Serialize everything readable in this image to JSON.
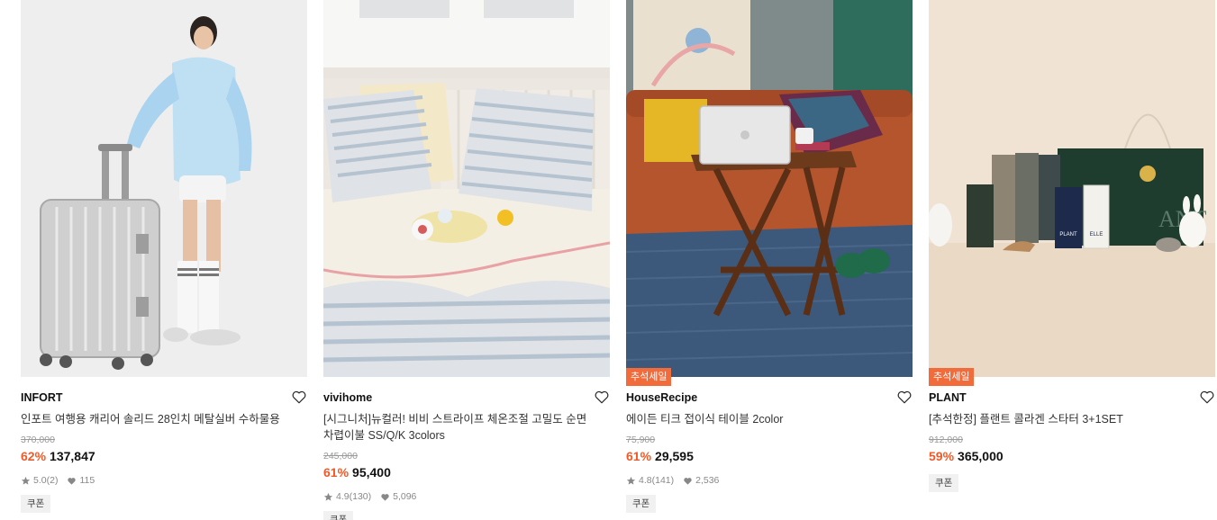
{
  "products": [
    {
      "brand": "INFORT",
      "title": "인포트 여행용 캐리어 솔리드 28인치 메탈실버 수하물용",
      "original_price": "370,000",
      "discount": "62%",
      "price": "137,847",
      "rating": "5.0",
      "review_count": "(2)",
      "likes": "115",
      "coupon": "쿠폰",
      "badge": ""
    },
    {
      "brand": "vivihome",
      "title": "[시그니처]뉴컬러! 비비 스트라이프 체온조절 고밀도 순면 차렵이불 SS/Q/K 3colors",
      "original_price": "245,000",
      "discount": "61%",
      "price": "95,400",
      "rating": "4.9",
      "review_count": "(130)",
      "likes": "5,096",
      "coupon": "쿠폰",
      "badge": ""
    },
    {
      "brand": "HouseRecipe",
      "title": "에이든 티크 접이식 테이블 2color",
      "original_price": "75,900",
      "discount": "61%",
      "price": "29,595",
      "rating": "4.8",
      "review_count": "(141)",
      "likes": "2,536",
      "coupon": "쿠폰",
      "badge": "추석세일"
    },
    {
      "brand": "PLANT",
      "title": "[추석한정] 플랜트 콜라겐 스타터 3+1SET",
      "original_price": "912,000",
      "discount": "59%",
      "price": "365,000",
      "rating": "",
      "review_count": "",
      "likes": "",
      "coupon": "쿠폰",
      "badge": "추석세일"
    }
  ],
  "image_text": {
    "plant_box_1": "PLANT",
    "plant_box_2": "ELLE",
    "plant_bag": "ANT"
  },
  "icons": {
    "like": "heart-outline-icon",
    "rating": "star-icon",
    "likes": "heart-filled-icon"
  },
  "colors": {
    "discount": "#ef5a28",
    "badge": "#f26b3a",
    "coupon_bg": "#f1f1f1"
  }
}
